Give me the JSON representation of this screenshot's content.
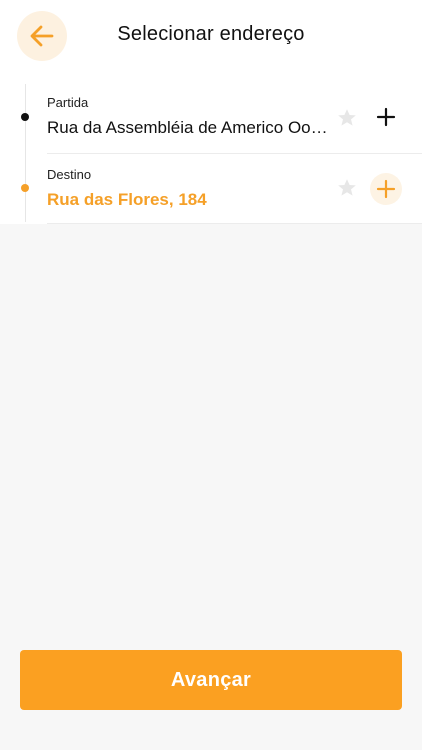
{
  "header": {
    "title": "Selecionar endereço",
    "back_icon": "arrow-left-icon"
  },
  "route": {
    "origin": {
      "label": "Partida",
      "address": "Rua da Assembléia de Americo Oobe…",
      "icons": [
        "star-icon",
        "plus-icon"
      ]
    },
    "destination": {
      "label": "Destino",
      "address": "Rua das Flores, 184",
      "icons": [
        "star-icon",
        "plus-icon"
      ]
    }
  },
  "footer": {
    "button_label": "Avançar"
  },
  "colors": {
    "accent": "#fba021",
    "accent_text": "#f5a028",
    "accent_soft": "#fdf1e0",
    "background": "#f7f7f7",
    "star_inactive": "#e7e7e7"
  }
}
